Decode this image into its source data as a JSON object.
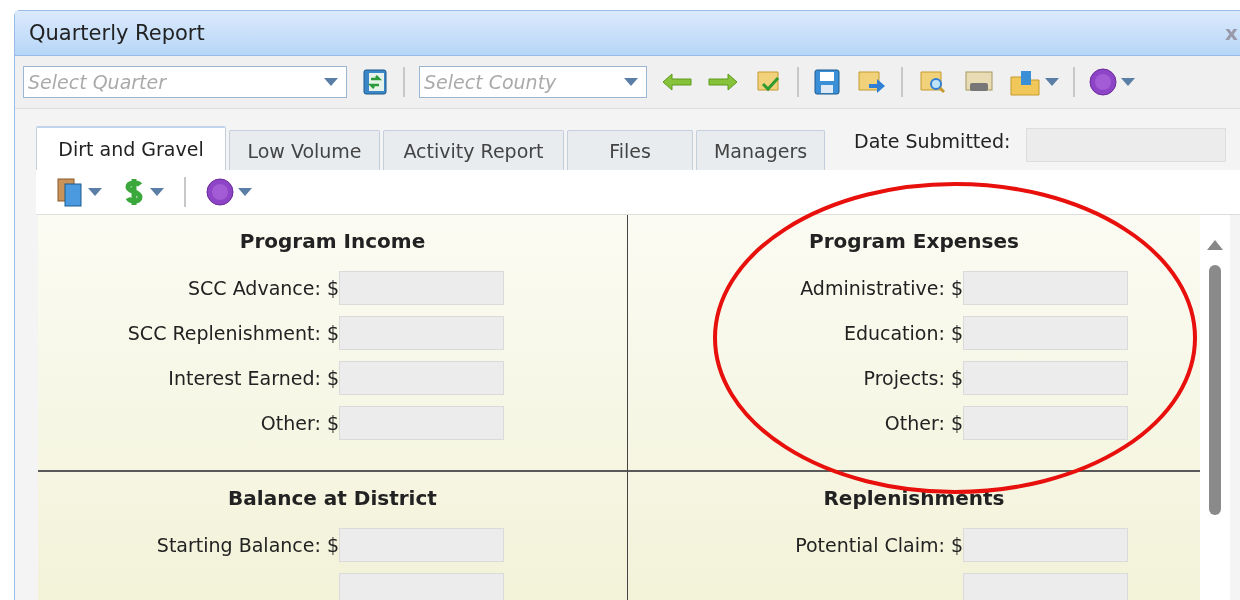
{
  "window": {
    "title": "Quarterly Report",
    "close": "x"
  },
  "toolbar": {
    "quarter": {
      "placeholder": "Select Quarter"
    },
    "county": {
      "placeholder": "Select County"
    }
  },
  "tabs": [
    {
      "label": "Dirt and Gravel",
      "selected": true
    },
    {
      "label": "Low Volume",
      "selected": false
    },
    {
      "label": "Activity Report",
      "selected": false
    },
    {
      "label": "Files",
      "selected": false
    },
    {
      "label": "Managers",
      "selected": false
    }
  ],
  "date_submitted": {
    "label": "Date Submitted:"
  },
  "sections": [
    {
      "title": "Program Income",
      "fields": [
        {
          "kind": "labeled",
          "label": "SCC Advance: $"
        },
        {
          "kind": "labeled",
          "label": "SCC Replenishment: $"
        },
        {
          "kind": "labeled",
          "label": "Interest Earned: $"
        },
        {
          "kind": "labeled",
          "label": "Other: $"
        }
      ]
    },
    {
      "title": "Program Expenses",
      "fields": [
        {
          "kind": "labeled",
          "label": "Administrative: $"
        },
        {
          "kind": "labeled",
          "label": "Education: $"
        },
        {
          "kind": "labeled",
          "label": "Projects: $"
        },
        {
          "kind": "labeled",
          "label": "Other: $"
        }
      ]
    },
    {
      "title": "Balance at District",
      "fields": [
        {
          "kind": "labeled",
          "label": "Starting Balance: $"
        },
        {
          "kind": "unlabeled"
        }
      ]
    },
    {
      "title": "Replenishments",
      "fields": [
        {
          "kind": "labeled",
          "label": "Potential Claim: $"
        },
        {
          "kind": "unlabeled"
        }
      ]
    }
  ]
}
